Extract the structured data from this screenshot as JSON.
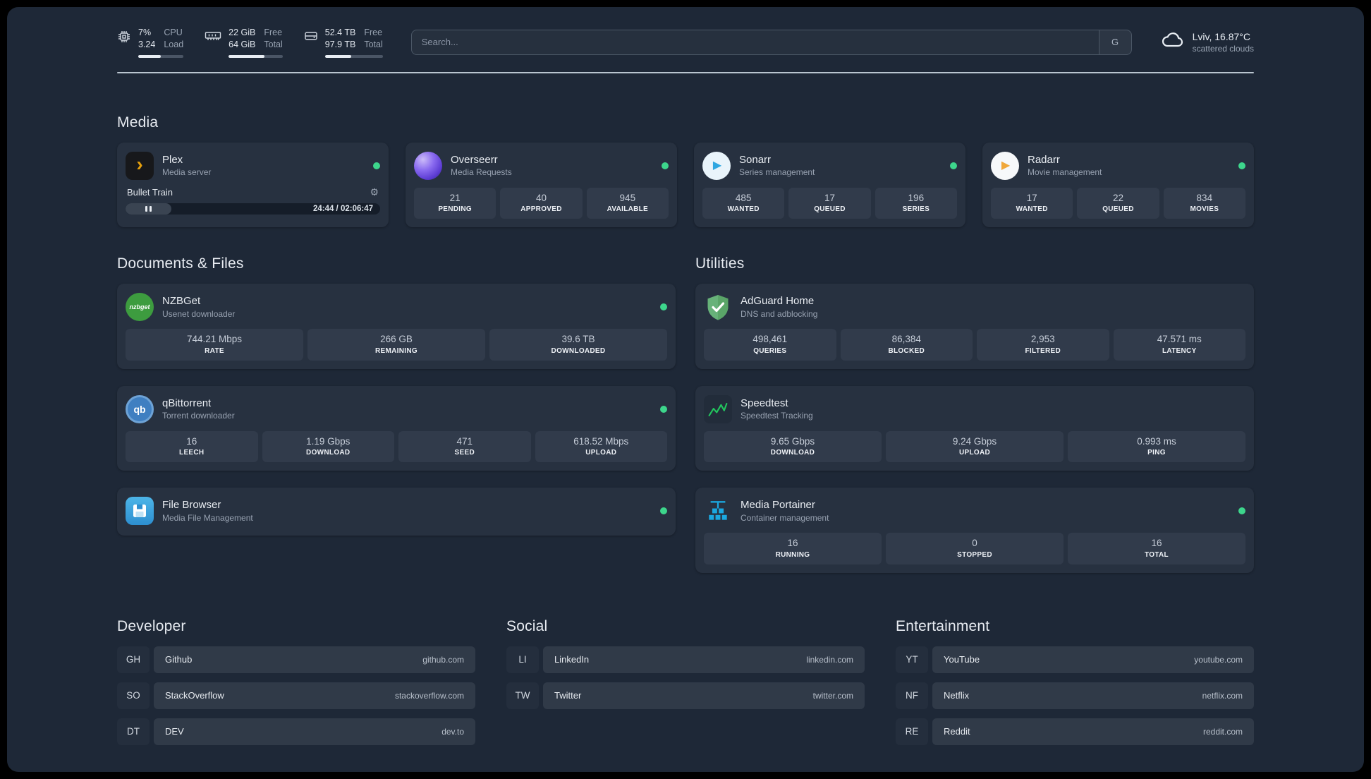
{
  "topbar": {
    "cpu": {
      "value1": "7%",
      "value2": "3.24",
      "label1": "CPU",
      "label2": "Load",
      "bar": 50
    },
    "memory": {
      "value1": "22 GiB",
      "value2": "64 GiB",
      "label1": "Free",
      "label2": "Total",
      "bar": 66
    },
    "disk": {
      "value1": "52.4 TB",
      "value2": "97.9 TB",
      "label1": "Free",
      "label2": "Total",
      "bar": 46
    },
    "search": {
      "placeholder": "Search...",
      "engine": "G"
    },
    "weather": {
      "location": "Lviv, 16.87°C",
      "condition": "scattered clouds"
    }
  },
  "media": {
    "title": "Media",
    "plex": {
      "name": "Plex",
      "desc": "Media server",
      "track": "Bullet Train",
      "time": "24:44 / 02:06:47",
      "progress": 18
    },
    "overseerr": {
      "name": "Overseerr",
      "desc": "Media Requests",
      "stats": [
        {
          "value": "21",
          "label": "PENDING"
        },
        {
          "value": "40",
          "label": "APPROVED"
        },
        {
          "value": "945",
          "label": "AVAILABLE"
        }
      ]
    },
    "sonarr": {
      "name": "Sonarr",
      "desc": "Series management",
      "stats": [
        {
          "value": "485",
          "label": "WANTED"
        },
        {
          "value": "17",
          "label": "QUEUED"
        },
        {
          "value": "196",
          "label": "SERIES"
        }
      ]
    },
    "radarr": {
      "name": "Radarr",
      "desc": "Movie management",
      "stats": [
        {
          "value": "17",
          "label": "WANTED"
        },
        {
          "value": "22",
          "label": "QUEUED"
        },
        {
          "value": "834",
          "label": "MOVIES"
        }
      ]
    }
  },
  "documents": {
    "title": "Documents & Files",
    "nzbget": {
      "name": "NZBGet",
      "desc": "Usenet downloader",
      "stats": [
        {
          "value": "744.21 Mbps",
          "label": "RATE"
        },
        {
          "value": "266 GB",
          "label": "REMAINING"
        },
        {
          "value": "39.6 TB",
          "label": "DOWNLOADED"
        }
      ]
    },
    "qbittorrent": {
      "name": "qBittorrent",
      "desc": "Torrent downloader",
      "stats": [
        {
          "value": "16",
          "label": "LEECH"
        },
        {
          "value": "1.19 Gbps",
          "label": "DOWNLOAD"
        },
        {
          "value": "471",
          "label": "SEED"
        },
        {
          "value": "618.52 Mbps",
          "label": "UPLOAD"
        }
      ]
    },
    "filebrowser": {
      "name": "File Browser",
      "desc": "Media File Management"
    }
  },
  "utilities": {
    "title": "Utilities",
    "adguard": {
      "name": "AdGuard Home",
      "desc": "DNS and adblocking",
      "stats": [
        {
          "value": "498,461",
          "label": "QUERIES"
        },
        {
          "value": "86,384",
          "label": "BLOCKED"
        },
        {
          "value": "2,953",
          "label": "FILTERED"
        },
        {
          "value": "47.571 ms",
          "label": "LATENCY"
        }
      ]
    },
    "speedtest": {
      "name": "Speedtest",
      "desc": "Speedtest Tracking",
      "stats": [
        {
          "value": "9.65 Gbps",
          "label": "DOWNLOAD"
        },
        {
          "value": "9.24 Gbps",
          "label": "UPLOAD"
        },
        {
          "value": "0.993 ms",
          "label": "PING"
        }
      ]
    },
    "portainer": {
      "name": "Media Portainer",
      "desc": "Container management",
      "stats": [
        {
          "value": "16",
          "label": "RUNNING"
        },
        {
          "value": "0",
          "label": "STOPPED"
        },
        {
          "value": "16",
          "label": "TOTAL"
        }
      ]
    }
  },
  "bookmarks": {
    "developer": {
      "title": "Developer",
      "items": [
        {
          "abbr": "GH",
          "name": "Github",
          "url": "github.com"
        },
        {
          "abbr": "SO",
          "name": "StackOverflow",
          "url": "stackoverflow.com"
        },
        {
          "abbr": "DT",
          "name": "DEV",
          "url": "dev.to"
        }
      ]
    },
    "social": {
      "title": "Social",
      "items": [
        {
          "abbr": "LI",
          "name": "LinkedIn",
          "url": "linkedin.com"
        },
        {
          "abbr": "TW",
          "name": "Twitter",
          "url": "twitter.com"
        }
      ]
    },
    "entertainment": {
      "title": "Entertainment",
      "items": [
        {
          "abbr": "YT",
          "name": "YouTube",
          "url": "youtube.com"
        },
        {
          "abbr": "NF",
          "name": "Netflix",
          "url": "netflix.com"
        },
        {
          "abbr": "RE",
          "name": "Reddit",
          "url": "reddit.com"
        }
      ]
    }
  },
  "glyphs": {
    "plex": "›",
    "play": "▶",
    "gear": "⚙",
    "qb": "qb",
    "nzbget": "nzbget"
  },
  "colors": {
    "status_online": "#3dd68c",
    "plex_accent": "#e5a00d",
    "adguard_green": "#67b279",
    "speedtest_green": "#22c55e",
    "portainer_blue": "#1ba8e0",
    "overseerr_purple": "#6d28d9"
  }
}
